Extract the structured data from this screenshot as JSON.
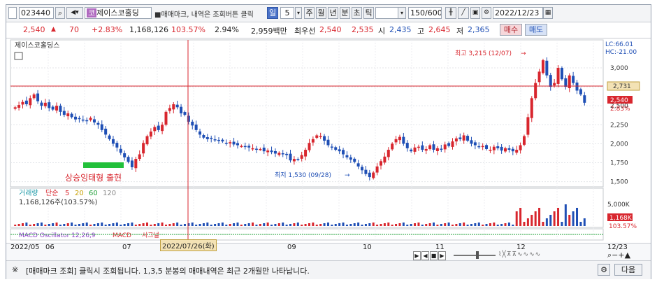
{
  "toolbar": {
    "code": "023440",
    "stock_name": "제이스코홀딩",
    "notice": "■매매마크, 내역은 조회버튼 클릭",
    "period_selected": "일",
    "period_value": "5",
    "period_buttons": [
      "주",
      "월",
      "년",
      "분",
      "초",
      "틱"
    ],
    "count": "150/600",
    "date": "2022/12/23"
  },
  "quote": {
    "price": "2,540",
    "change": "70",
    "change_pct": "+2.83%",
    "volume": "1,168,126",
    "vol_ratio": "103.57%",
    "turnover": "2.94%",
    "amount": "2,959백만",
    "priority_label": "최우선",
    "ask": "2,540",
    "bid": "2,535",
    "open_label": "시",
    "open": "2,435",
    "high_label": "고",
    "high": "2,645",
    "low_label": "저",
    "low": "2,365",
    "buy_label": "매수",
    "sell_label": "매도"
  },
  "chart": {
    "title": "제이스코홀딩스",
    "lc": "LC:66.01",
    "hc": "HC:-21.00",
    "high_annotation": "최고 3,215 (12/07)",
    "low_annotation": "최저 1,530 (09/28)",
    "pattern_label": "상승잉태형 출현",
    "crosshair_value": "2,731",
    "last_price_box": "2,540",
    "last_pct": "2.83%",
    "price_ticks": [
      "3,000",
      "2,750",
      "2,500",
      "2,250",
      "2,000",
      "1,750",
      "1,500"
    ],
    "volume_title": "거래량",
    "volume_ma": "단순",
    "ma_values": [
      "5",
      "20",
      "60",
      "120"
    ],
    "volume_value": "1,168,126주(103.57%)",
    "volume_tick": "5,000K",
    "volume_box": "1,168K",
    "volume_pct": "103.57%",
    "macd_label": "MACD Oscillator 12,26,9",
    "macd_label2": "MACD",
    "macd_label3": "시그널",
    "crosshair_date": "2022/07/26(화)",
    "x_labels": [
      "2022/05",
      "06",
      "07",
      "09",
      "10",
      "11",
      "12",
      "12/23"
    ]
  },
  "chart_data": {
    "type": "candlestick",
    "ylim": [
      1450,
      3350
    ],
    "closes": [
      2480,
      2510,
      2550,
      2520,
      2600,
      2650,
      2560,
      2500,
      2540,
      2470,
      2450,
      2500,
      2420,
      2380,
      2400,
      2350,
      2320,
      2330,
      2310,
      2300,
      2340,
      2280,
      2250,
      2180,
      2120,
      2060,
      2000,
      1950,
      1880,
      1820,
      1760,
      1690,
      1800,
      1860,
      2010,
      2100,
      2160,
      2220,
      2180,
      2250,
      2420,
      2470,
      2520,
      2480,
      2400,
      2380,
      2290,
      2240,
      2180,
      2120,
      2080,
      2060,
      2070,
      2050,
      2040,
      2030,
      2010,
      2020,
      1990,
      1980,
      1970,
      1960,
      1950,
      1940,
      1920,
      1930,
      1900,
      1910,
      1890,
      1870,
      1880,
      1860,
      1850,
      1780,
      1800,
      1790,
      1850,
      1920,
      2010,
      2060,
      2110,
      2100,
      2040,
      1980,
      1960,
      1920,
      1900,
      1860,
      1820,
      1790,
      1760,
      1700,
      1650,
      1600,
      1560,
      1620,
      1700,
      1770,
      1830,
      1920,
      2000,
      2060,
      2090,
      2000,
      1940,
      1900,
      1950,
      1960,
      1920,
      1930,
      1980,
      1920,
      1940,
      1920,
      1990,
      1970,
      2030,
      2070,
      2060,
      2110,
      2040,
      2000,
      1980,
      1960,
      1970,
      1930,
      1920,
      1960,
      1940,
      1910,
      1940,
      1920,
      1900,
      1920,
      1980,
      2100,
      2350,
      2600,
      2800,
      2950,
      3100,
      2900,
      2750,
      2800,
      3000,
      2850,
      2750,
      2900,
      2800,
      2700,
      2650,
      2540
    ]
  },
  "footer": {
    "icon_label": "※",
    "message": "[매매마크 조회] 클릭시 조회됩니다. 1,3,5 분봉의 매매내역은 최근 2개월만 나타납니다.",
    "next_label": "다음"
  },
  "colors": {
    "up": "#d8262e",
    "down": "#1f4fb5",
    "crosshair": "#d8262e",
    "highlight": "#22c03a"
  }
}
